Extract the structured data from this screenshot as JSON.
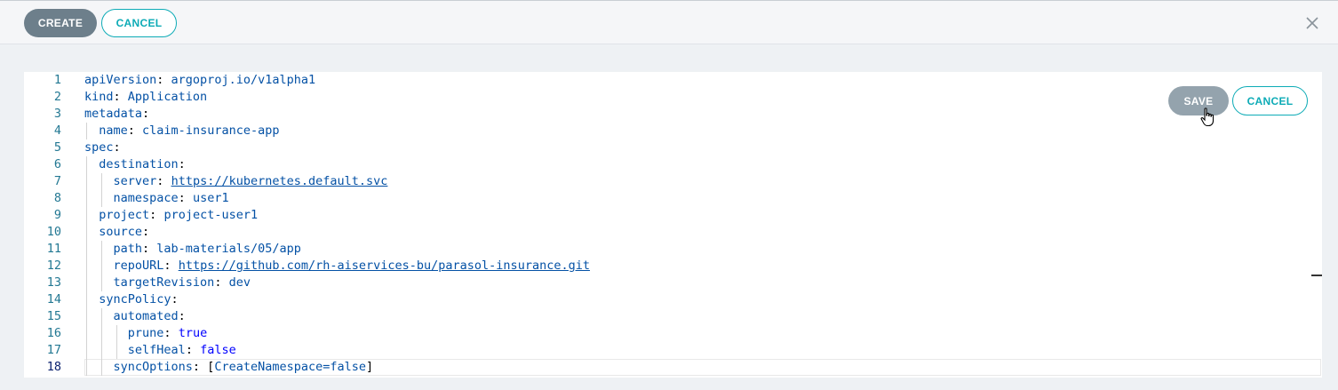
{
  "toolbar": {
    "create_label": "CREATE",
    "cancel_label": "CANCEL",
    "close_icon": "close-icon"
  },
  "editor": {
    "save_label": "SAVE",
    "cancel_label": "CANCEL",
    "current_line": 18,
    "lines": [
      {
        "n": "1",
        "key": "apiVersion",
        "value": "argoproj.io/v1alpha1"
      },
      {
        "n": "2",
        "key": "kind",
        "value": "Application"
      },
      {
        "n": "3",
        "key": "metadata",
        "value": ""
      },
      {
        "n": "4",
        "key": "name",
        "value": "claim-insurance-app"
      },
      {
        "n": "5",
        "key": "spec",
        "value": ""
      },
      {
        "n": "6",
        "key": "destination",
        "value": ""
      },
      {
        "n": "7",
        "key": "server",
        "value": "https://kubernetes.default.svc"
      },
      {
        "n": "8",
        "key": "namespace",
        "value": "user1"
      },
      {
        "n": "9",
        "key": "project",
        "value": "project-user1"
      },
      {
        "n": "10",
        "key": "source",
        "value": ""
      },
      {
        "n": "11",
        "key": "path",
        "value": "lab-materials/05/app"
      },
      {
        "n": "12",
        "key": "repoURL",
        "value": "https://github.com/rh-aiservices-bu/parasol-insurance.git"
      },
      {
        "n": "13",
        "key": "targetRevision",
        "value": "dev"
      },
      {
        "n": "14",
        "key": "syncPolicy",
        "value": ""
      },
      {
        "n": "15",
        "key": "automated",
        "value": ""
      },
      {
        "n": "16",
        "key": "prune",
        "value": "true"
      },
      {
        "n": "17",
        "key": "selfHeal",
        "value": "false"
      },
      {
        "n": "18",
        "key": "syncOptions",
        "value": "CreateNamespace=false"
      }
    ]
  },
  "colors": {
    "accent": "#0dabb6",
    "create_bg": "#6d7f8b",
    "save_bg": "#94a3ad"
  }
}
